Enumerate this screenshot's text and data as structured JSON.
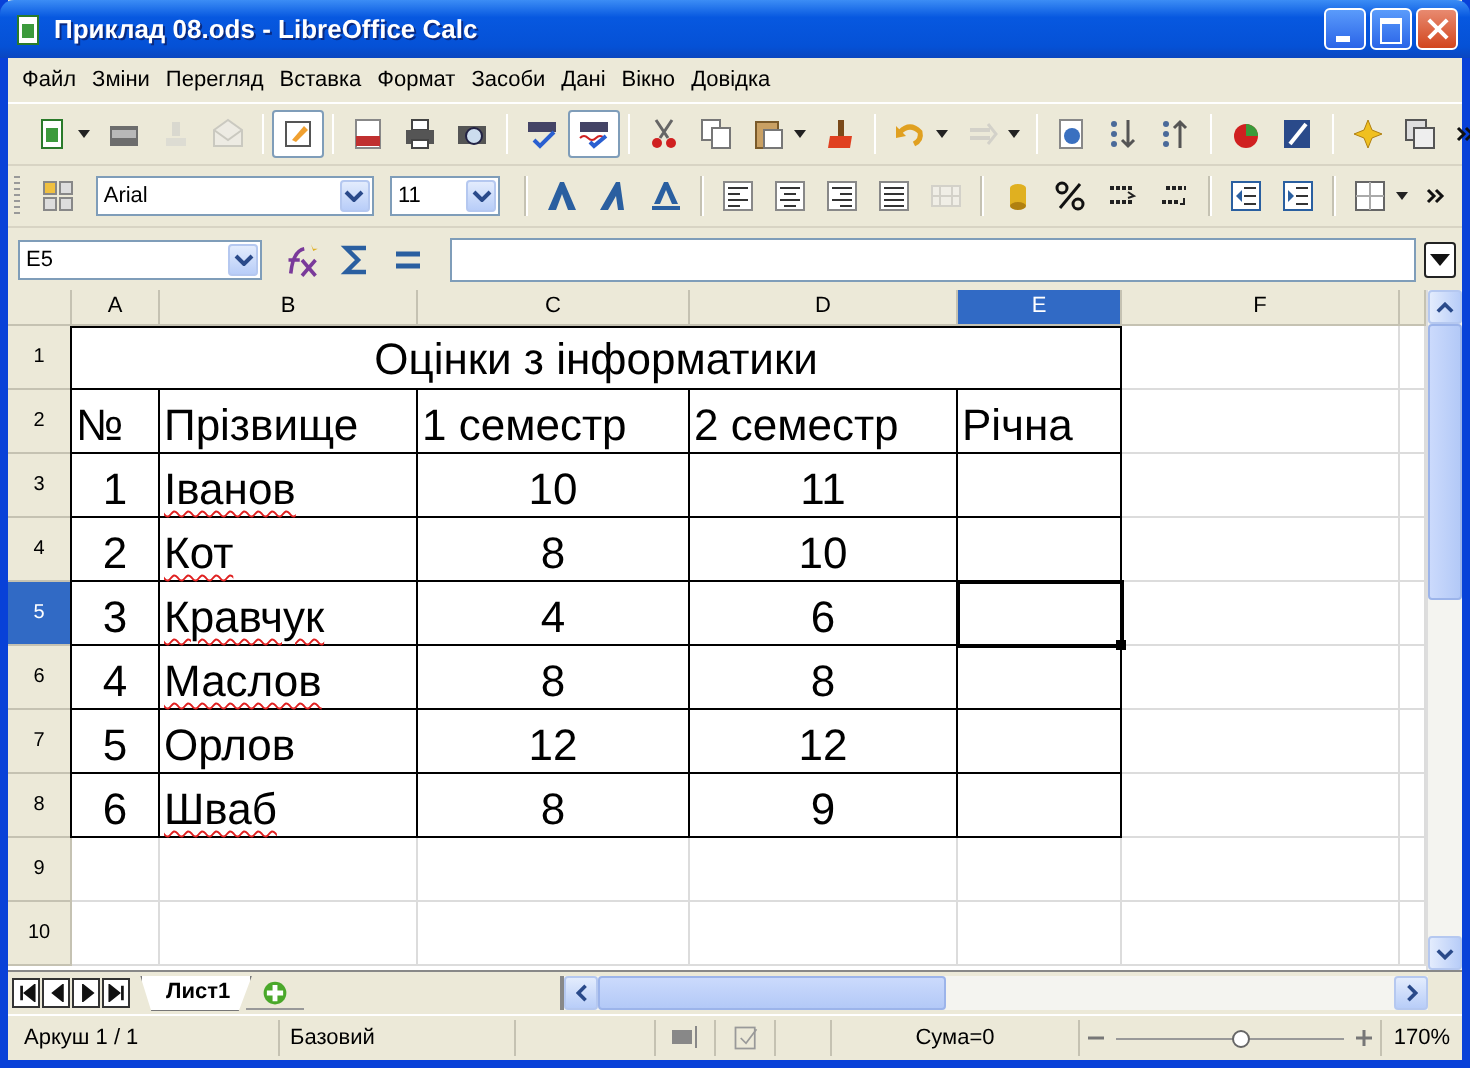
{
  "window": {
    "title": "Приклад 08.ods - LibreOffice Calc"
  },
  "menu": [
    "Файл",
    "Зміни",
    "Перегляд",
    "Вставка",
    "Формат",
    "Засоби",
    "Дані",
    "Вікно",
    "Довідка"
  ],
  "toolbar": {
    "edit_mode": true,
    "auto_spellcheck": true
  },
  "formatting": {
    "font_name": "Arial",
    "font_size": "11"
  },
  "formula_bar": {
    "name_box": "E5"
  },
  "sheet": {
    "columns": [
      {
        "label": "A",
        "selected": false
      },
      {
        "label": "B",
        "selected": false
      },
      {
        "label": "C",
        "selected": false
      },
      {
        "label": "D",
        "selected": false
      },
      {
        "label": "E",
        "selected": true
      },
      {
        "label": "F",
        "selected": false
      }
    ],
    "rows": [
      {
        "label": "1",
        "selected": false
      },
      {
        "label": "2",
        "selected": false
      },
      {
        "label": "3",
        "selected": false
      },
      {
        "label": "4",
        "selected": false
      },
      {
        "label": "5",
        "selected": true
      },
      {
        "label": "6",
        "selected": false
      },
      {
        "label": "7",
        "selected": false
      },
      {
        "label": "8",
        "selected": false
      },
      {
        "label": "9",
        "selected": false
      },
      {
        "label": "10",
        "selected": false
      }
    ],
    "title": "Оцінки з інформатики",
    "header": [
      "№",
      "Прізвище",
      "1 семестр",
      "2 семестр",
      "Річна"
    ],
    "records": [
      {
        "number": "1",
        "surname": "Іванов",
        "spell_error": true,
        "semester_1": "10",
        "semester_2": "11"
      },
      {
        "number": "2",
        "surname": "Кот",
        "spell_error": true,
        "semester_1": "8",
        "semester_2": "10"
      },
      {
        "number": "3",
        "surname": "Кравчук",
        "spell_error": true,
        "semester_1": "4",
        "semester_2": "6"
      },
      {
        "number": "4",
        "surname": "Маслов",
        "spell_error": true,
        "semester_1": "8",
        "semester_2": "8"
      },
      {
        "number": "5",
        "surname": "Орлов",
        "spell_error": false,
        "semester_1": "12",
        "semester_2": "12"
      },
      {
        "number": "6",
        "surname": "Шваб",
        "spell_error": true,
        "semester_1": "8",
        "semester_2": "9"
      }
    ]
  },
  "sheet_tabs": [
    {
      "label": "Лист1",
      "selected": true
    }
  ],
  "status_bar": {
    "sheet": "Аркуш 1 / 1",
    "page_style": "Базовий",
    "sum": "Сума=0",
    "zoom": {
      "level": 0.55
    },
    "zoom_text": "170%"
  }
}
